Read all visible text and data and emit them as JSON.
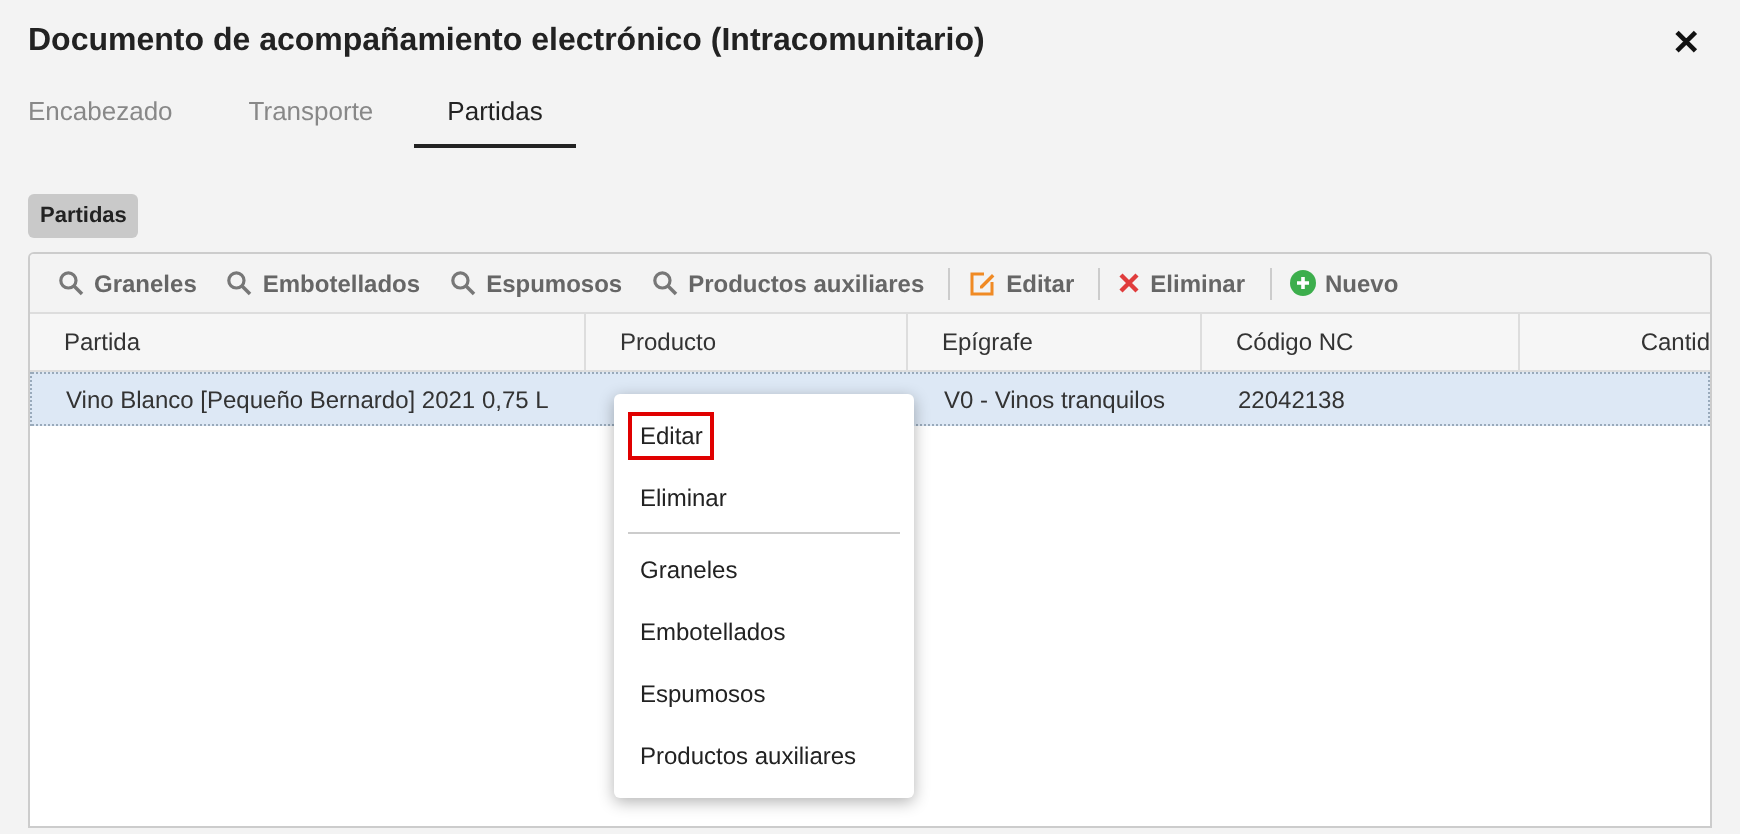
{
  "window": {
    "title": "Documento de acompañamiento electrónico (Intracomunitario)",
    "close": "✕"
  },
  "tabs": [
    {
      "label": "Encabezado",
      "selected": false
    },
    {
      "label": "Transporte",
      "selected": false
    },
    {
      "label": "Partidas",
      "selected": true
    }
  ],
  "section_label": "Partidas",
  "toolbar": {
    "groups": [
      [
        {
          "kind": "search",
          "label": "Graneles"
        },
        {
          "kind": "search",
          "label": "Embotellados"
        },
        {
          "kind": "search",
          "label": "Espumosos"
        },
        {
          "kind": "search",
          "label": "Productos auxiliares"
        }
      ],
      [
        {
          "kind": "edit",
          "label": "Editar"
        }
      ],
      [
        {
          "kind": "delete",
          "label": "Eliminar"
        }
      ],
      [
        {
          "kind": "add",
          "label": "Nuevo"
        }
      ]
    ]
  },
  "table": {
    "columns": [
      "Partida",
      "Producto",
      "Epígrafe",
      "Código NC",
      "Cantid"
    ],
    "rows": [
      {
        "selected": true,
        "cells": [
          "Vino Blanco [Pequeño Bernardo] 2021 0,75 L",
          "",
          "V0 - Vinos tranquilos",
          "22042138",
          ""
        ]
      }
    ]
  },
  "context_menu": {
    "groups": [
      [
        {
          "label": "Editar",
          "highlighted": true
        },
        {
          "label": "Eliminar",
          "highlighted": false
        }
      ],
      [
        {
          "label": "Graneles",
          "highlighted": false
        },
        {
          "label": "Embotellados",
          "highlighted": false
        },
        {
          "label": "Espumosos",
          "highlighted": false
        },
        {
          "label": "Productos auxiliares",
          "highlighted": false
        }
      ]
    ]
  }
}
